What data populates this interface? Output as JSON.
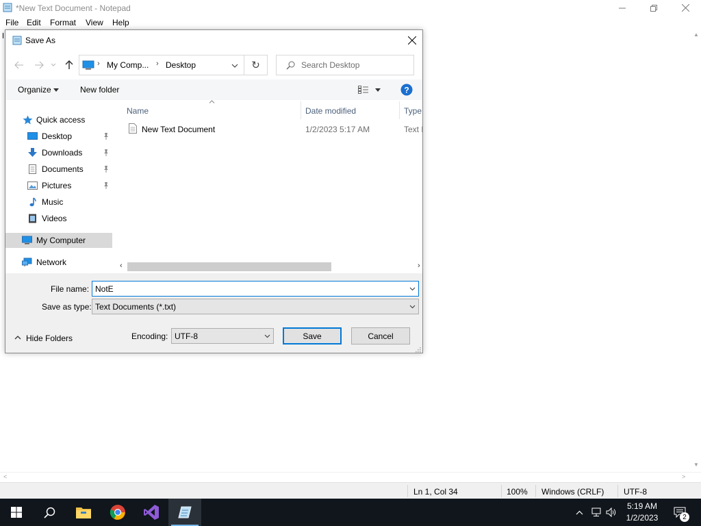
{
  "notepad": {
    "title": "*New Text Document - Notepad",
    "menu": [
      "File",
      "Edit",
      "Format",
      "View",
      "Help"
    ],
    "status": {
      "position": "Ln 1, Col 34",
      "zoom": "100%",
      "line_ending": "Windows (CRLF)",
      "encoding": "UTF-8"
    }
  },
  "dialog": {
    "title": "Save As",
    "breadcrumb": [
      "My Comp...",
      "Desktop"
    ],
    "search_placeholder": "Search Desktop",
    "toolbar": {
      "organize": "Organize",
      "new_folder": "New folder"
    },
    "nav": {
      "quick_access": "Quick access",
      "desktop": "Desktop",
      "downloads": "Downloads",
      "documents": "Documents",
      "pictures": "Pictures",
      "music": "Music",
      "videos": "Videos",
      "my_computer": "My Computer",
      "network": "Network"
    },
    "columns": {
      "name": "Name",
      "date_modified": "Date modified",
      "type": "Type"
    },
    "files": [
      {
        "name": "New Text Document",
        "date_modified": "1/2/2023 5:17 AM",
        "type": "Text D"
      }
    ],
    "file_name_label": "File name:",
    "file_name_value": "NotE",
    "save_as_type_label": "Save as type:",
    "save_as_type_value": "Text Documents (*.txt)",
    "hide_folders": "Hide Folders",
    "encoding_label": "Encoding:",
    "encoding_value": "UTF-8",
    "save_button": "Save",
    "cancel_button": "Cancel"
  },
  "taskbar": {
    "clock_time": "5:19 AM",
    "clock_date": "1/2/2023",
    "notification_count": "2"
  }
}
